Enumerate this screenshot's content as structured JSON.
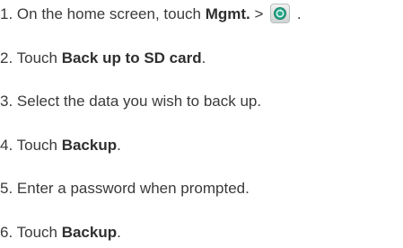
{
  "steps": [
    {
      "num": "1.",
      "pre": "On the home screen, touch ",
      "bold": "Mgmt.",
      "post": " > ",
      "tail": " ."
    },
    {
      "num": "2.",
      "pre": "Touch ",
      "bold": "Back up to SD card",
      "post": "."
    },
    {
      "num": "3.",
      "text": "Select the data you wish to back up."
    },
    {
      "num": "4.",
      "pre": "Touch ",
      "bold": "Backup",
      "post": "."
    },
    {
      "num": "5.",
      "text": "Enter a password when prompted."
    },
    {
      "num": "6.",
      "pre": "Touch ",
      "bold": "Backup",
      "post": "."
    }
  ],
  "icons": {
    "backup_app": "backup-app-icon",
    "accent": "#2aa68a"
  }
}
